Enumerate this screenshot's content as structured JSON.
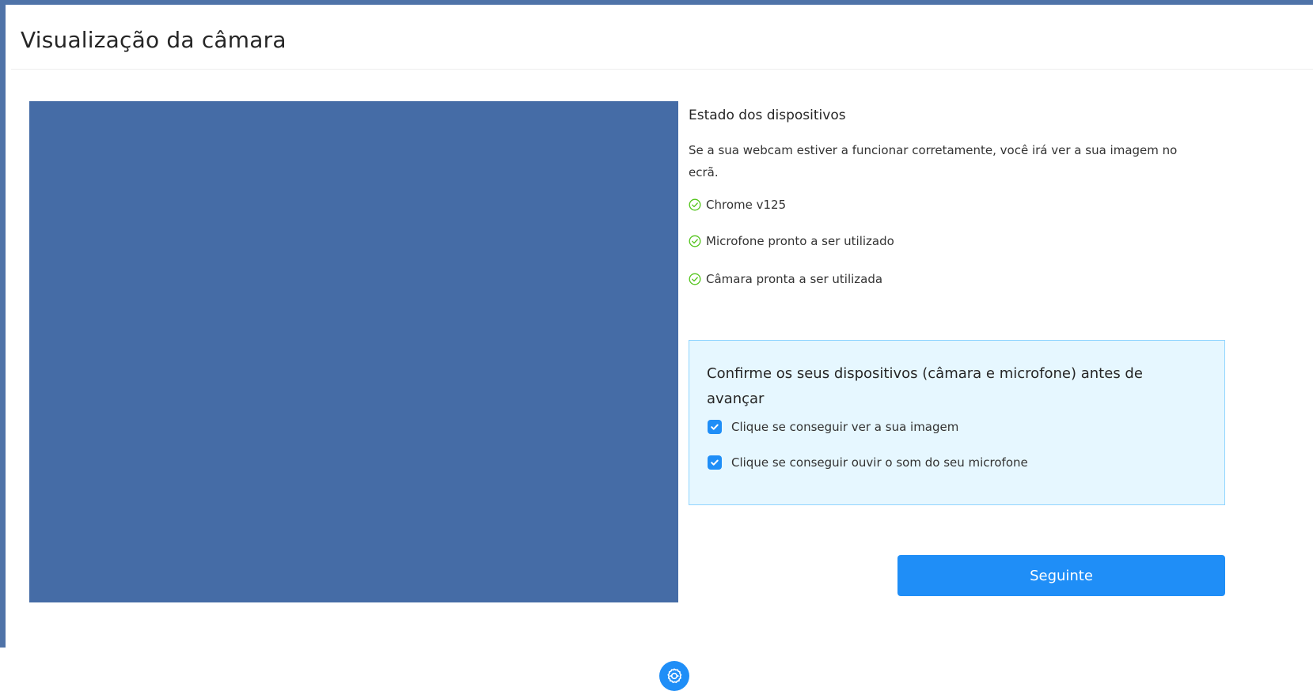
{
  "header": {
    "title": "Visualização da câmara"
  },
  "device_status": {
    "heading": "Estado dos dispositivos",
    "intro": "Se a sua webcam estiver a funcionar corretamente, você irá ver a sua imagem no ecrã.",
    "items": [
      {
        "label": "Chrome v125",
        "icon": "check-circle-icon"
      },
      {
        "label": "Microfone pronto a ser utilizado",
        "icon": "check-circle-icon"
      },
      {
        "label": "Câmara pronta a ser utilizada",
        "icon": "check-circle-icon"
      }
    ]
  },
  "confirm": {
    "title": "Confirme os seus dispositivos (câmara e microfone) antes de avançar",
    "checks": [
      {
        "label": "Clique se conseguir ver a sua imagem",
        "checked": true
      },
      {
        "label": "Clique se conseguir ouvir o som do seu microfone",
        "checked": true
      }
    ]
  },
  "actions": {
    "next_label": "Seguinte"
  },
  "colors": {
    "primary": "#1f8ef7",
    "video_bg": "#456ca6",
    "frame": "#4f73a8",
    "success": "#52c41a",
    "info_bg": "#e6f7ff",
    "info_border": "#91d5ff"
  }
}
